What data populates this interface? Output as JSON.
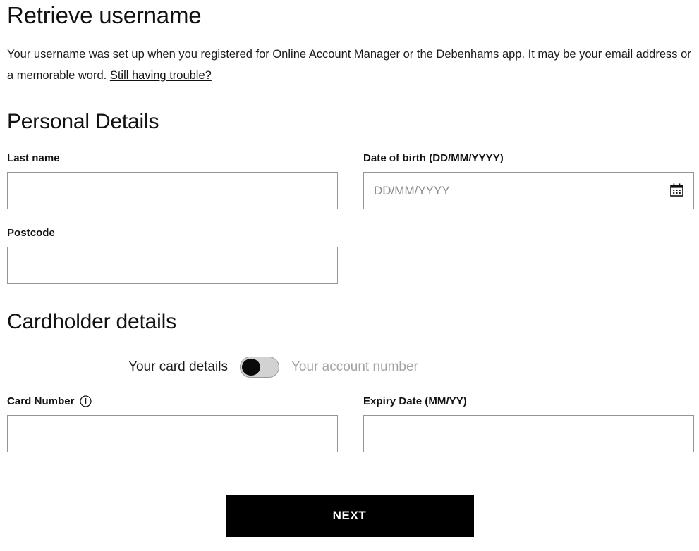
{
  "page": {
    "title": "Retrieve username",
    "intro_text": "Your username was set up when you registered for Online Account Manager or the Debenhams app. It may be your email address or a memorable word. ",
    "help_link_label": "Still having trouble?"
  },
  "personal_details": {
    "heading": "Personal Details",
    "last_name": {
      "label": "Last name",
      "value": "",
      "placeholder": ""
    },
    "date_of_birth": {
      "label": "Date of birth (DD/MM/YYYY)",
      "value": "",
      "placeholder": "DD/MM/YYYY",
      "icon": "calendar-icon"
    },
    "postcode": {
      "label": "Postcode",
      "value": "",
      "placeholder": ""
    }
  },
  "cardholder_details": {
    "heading": "Cardholder details",
    "toggle": {
      "left_label": "Your card details",
      "right_label": "Your account number",
      "state": "left",
      "knob_color": "#0a0a0a",
      "track_color": "#d2d2d2"
    },
    "card_number": {
      "label": "Card Number",
      "info_icon": "info-icon",
      "value": "",
      "placeholder": ""
    },
    "expiry_date": {
      "label": "Expiry Date (MM/YY)",
      "value": "",
      "placeholder": ""
    }
  },
  "actions": {
    "next_label": "NEXT",
    "next_bg": "#000000",
    "next_color": "#ffffff"
  }
}
